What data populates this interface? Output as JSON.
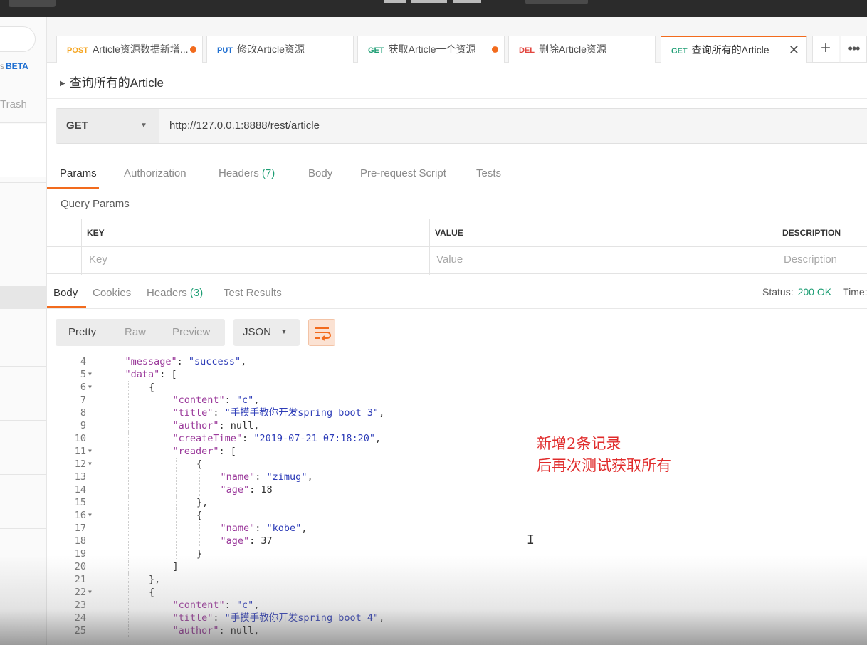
{
  "sidebar": {
    "beta_label": "BETA",
    "beta_prefix": "s",
    "trash_label": "Trash"
  },
  "tabs": [
    {
      "method": "POST",
      "label": "Article资源数据新增...",
      "unsaved": true
    },
    {
      "method": "PUT",
      "label": "修改Article资源",
      "unsaved": false
    },
    {
      "method": "GET",
      "label": "获取Article一个资源",
      "unsaved": true
    },
    {
      "method": "DEL",
      "label": "删除Article资源",
      "unsaved": false
    },
    {
      "method": "GET",
      "label": "查询所有的Article",
      "active": true,
      "close": "✕"
    }
  ],
  "tab_actions": {
    "add": "+",
    "more": "•••"
  },
  "request": {
    "name": "查询所有的Article",
    "method": "GET",
    "url": "http://127.0.0.1:8888/rest/article"
  },
  "request_tabs": {
    "params": "Params",
    "authorization": "Authorization",
    "headers": "Headers",
    "headers_count": "(7)",
    "body": "Body",
    "prerequest": "Pre-request Script",
    "tests": "Tests"
  },
  "query_params": {
    "title": "Query Params",
    "col_key": "KEY",
    "col_value": "VALUE",
    "col_description": "DESCRIPTION",
    "key_placeholder": "Key",
    "value_placeholder": "Value",
    "description_placeholder": "Description"
  },
  "response_tabs": {
    "body": "Body",
    "cookies": "Cookies",
    "headers": "Headers",
    "headers_count": "(3)",
    "test_results": "Test Results"
  },
  "status": {
    "label": "Status:",
    "value": "200 OK",
    "time_label": "Time:"
  },
  "view_modes": {
    "pretty": "Pretty",
    "raw": "Raw",
    "preview": "Preview",
    "format": "JSON"
  },
  "code_lines": [
    {
      "n": "4",
      "fold": false,
      "indent": 1,
      "parts": [
        [
          "k",
          "\"message\""
        ],
        [
          "p",
          ": "
        ],
        [
          "s",
          "\"success\""
        ],
        [
          "p",
          ","
        ]
      ]
    },
    {
      "n": "5",
      "fold": true,
      "indent": 1,
      "parts": [
        [
          "k",
          "\"data\""
        ],
        [
          "p",
          ": ["
        ]
      ]
    },
    {
      "n": "6",
      "fold": true,
      "indent": 2,
      "parts": [
        [
          "p",
          "{"
        ]
      ]
    },
    {
      "n": "7",
      "fold": false,
      "indent": 3,
      "parts": [
        [
          "k",
          "\"content\""
        ],
        [
          "p",
          ": "
        ],
        [
          "s",
          "\"c\""
        ],
        [
          "p",
          ","
        ]
      ]
    },
    {
      "n": "8",
      "fold": false,
      "indent": 3,
      "parts": [
        [
          "k",
          "\"title\""
        ],
        [
          "p",
          ": "
        ],
        [
          "s",
          "\"手摸手教你开发spring boot 3\""
        ],
        [
          "p",
          ","
        ]
      ]
    },
    {
      "n": "9",
      "fold": false,
      "indent": 3,
      "parts": [
        [
          "k",
          "\"author\""
        ],
        [
          "p",
          ": null,"
        ]
      ]
    },
    {
      "n": "10",
      "fold": false,
      "indent": 3,
      "parts": [
        [
          "k",
          "\"createTime\""
        ],
        [
          "p",
          ": "
        ],
        [
          "s",
          "\"2019-07-21 07:18:20\""
        ],
        [
          "p",
          ","
        ]
      ]
    },
    {
      "n": "11",
      "fold": true,
      "indent": 3,
      "parts": [
        [
          "k",
          "\"reader\""
        ],
        [
          "p",
          ": ["
        ]
      ]
    },
    {
      "n": "12",
      "fold": true,
      "indent": 4,
      "parts": [
        [
          "p",
          "{"
        ]
      ]
    },
    {
      "n": "13",
      "fold": false,
      "indent": 5,
      "parts": [
        [
          "k",
          "\"name\""
        ],
        [
          "p",
          ": "
        ],
        [
          "s",
          "\"zimug\""
        ],
        [
          "p",
          ","
        ]
      ]
    },
    {
      "n": "14",
      "fold": false,
      "indent": 5,
      "parts": [
        [
          "k",
          "\"age\""
        ],
        [
          "p",
          ": 18"
        ]
      ]
    },
    {
      "n": "15",
      "fold": false,
      "indent": 4,
      "parts": [
        [
          "p",
          "},"
        ]
      ]
    },
    {
      "n": "16",
      "fold": true,
      "indent": 4,
      "parts": [
        [
          "p",
          "{"
        ]
      ]
    },
    {
      "n": "17",
      "fold": false,
      "indent": 5,
      "parts": [
        [
          "k",
          "\"name\""
        ],
        [
          "p",
          ": "
        ],
        [
          "s",
          "\"kobe\""
        ],
        [
          "p",
          ","
        ]
      ]
    },
    {
      "n": "18",
      "fold": false,
      "indent": 5,
      "parts": [
        [
          "k",
          "\"age\""
        ],
        [
          "p",
          ": 37"
        ]
      ]
    },
    {
      "n": "19",
      "fold": false,
      "indent": 4,
      "parts": [
        [
          "p",
          "}"
        ]
      ]
    },
    {
      "n": "20",
      "fold": false,
      "indent": 3,
      "parts": [
        [
          "p",
          "]"
        ]
      ]
    },
    {
      "n": "21",
      "fold": false,
      "indent": 2,
      "parts": [
        [
          "p",
          "},"
        ]
      ]
    },
    {
      "n": "22",
      "fold": true,
      "indent": 2,
      "parts": [
        [
          "p",
          "{"
        ]
      ]
    },
    {
      "n": "23",
      "fold": false,
      "indent": 3,
      "parts": [
        [
          "k",
          "\"content\""
        ],
        [
          "p",
          ": "
        ],
        [
          "s",
          "\"c\""
        ],
        [
          "p",
          ","
        ]
      ]
    },
    {
      "n": "24",
      "fold": false,
      "indent": 3,
      "parts": [
        [
          "k",
          "\"title\""
        ],
        [
          "p",
          ": "
        ],
        [
          "s",
          "\"手摸手教你开发spring boot 4\""
        ],
        [
          "p",
          ","
        ]
      ]
    },
    {
      "n": "25",
      "fold": false,
      "indent": 3,
      "parts": [
        [
          "k",
          "\"author\""
        ],
        [
          "p",
          ": null,"
        ]
      ]
    }
  ],
  "annotation": {
    "line1": "新增2条记录",
    "line2": "后再次测试获取所有"
  },
  "colors": {
    "accent": "#f26b1d",
    "get": "#1e9e74",
    "post": "#f5a623",
    "put": "#1f6fd1",
    "del": "#e2463f",
    "annotation": "#e02b2b"
  }
}
